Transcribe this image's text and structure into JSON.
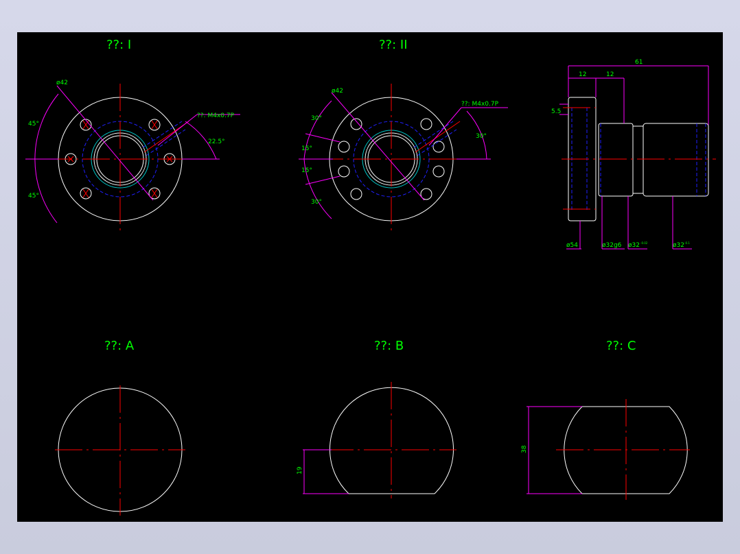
{
  "colors": {
    "background": "#000000",
    "outline": "#ffffff",
    "centerline": "#ff0000",
    "dimension": "#ff00ff",
    "hidden": "#0000ff",
    "thread": "#00c0c0",
    "text": "#00ff00",
    "frame": "#cfd3e3"
  },
  "views": {
    "view1": {
      "title": "??: I",
      "dia": "ø42",
      "thread": "??: M4x0.7P",
      "ang_top": "45°",
      "ang_bot": "45°",
      "ang_right": "22.5°"
    },
    "view2": {
      "title": "??: II",
      "dia": "ø42",
      "thread": "??: M4x0.7P",
      "ang_a": "30°",
      "ang_b": "15°",
      "ang_c": "15°",
      "ang_d": "30°",
      "ang_right": "30°"
    },
    "side": {
      "total": "61",
      "d1": "12",
      "d2": "12",
      "d3": "5.5",
      "dia1": "ø54",
      "dia2": "ø32g6",
      "dia3": "ø32",
      "dia3_tol": "-0.02",
      "dia4": "ø32",
      "dia4_tol": "-0.1"
    },
    "a": {
      "title": "??: A"
    },
    "b": {
      "title": "??: B",
      "dim": "19"
    },
    "c": {
      "title": "??: C",
      "dim": "38"
    }
  }
}
